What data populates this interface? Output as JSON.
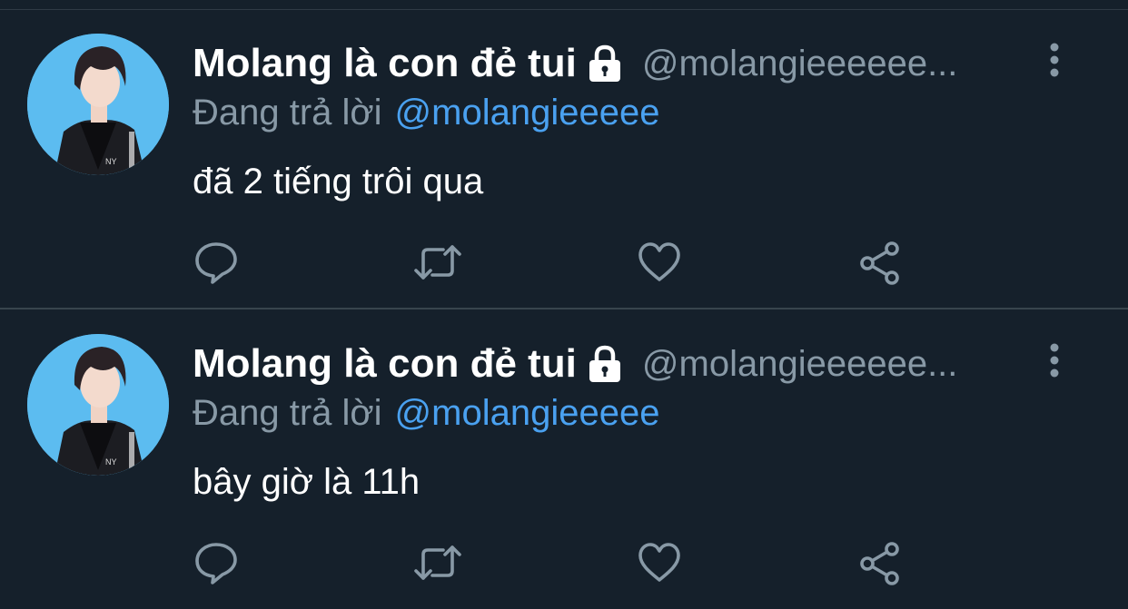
{
  "colors": {
    "background": "#15202b",
    "divider": "#38444d",
    "text_primary": "#ffffff",
    "text_secondary": "#8899a6",
    "link": "#4aa1f0",
    "avatar_bg": "#5cbcf0"
  },
  "tweets": [
    {
      "display_name": "Molang là con đẻ tui",
      "handle": "@molangieeeeee...",
      "reply_prefix": "Đang trả lời",
      "reply_to": "@molangieeeee",
      "text": "đã 2 tiếng trôi qua",
      "icons": [
        "lock-icon",
        "more-vertical-icon",
        "reply-icon",
        "retweet-icon",
        "like-icon",
        "share-icon"
      ]
    },
    {
      "display_name": "Molang là con đẻ tui",
      "handle": "@molangieeeeee...",
      "reply_prefix": "Đang trả lời",
      "reply_to": "@molangieeeee",
      "text": "bây giờ là 11h",
      "icons": [
        "lock-icon",
        "more-vertical-icon",
        "reply-icon",
        "retweet-icon",
        "like-icon",
        "share-icon"
      ]
    }
  ]
}
